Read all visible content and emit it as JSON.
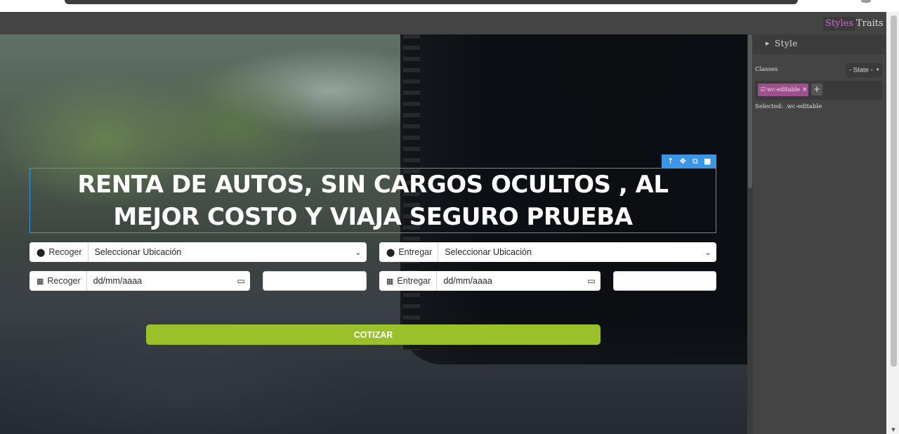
{
  "panel": {
    "tabs": [
      {
        "label": "Styles",
        "active": true
      },
      {
        "label": "Traits",
        "active": false
      }
    ],
    "sector_title": "Style",
    "classes_label": "Classes",
    "state_select": "- State -",
    "class_tag": "wc-editable",
    "class_tag_remove": "×",
    "add_class": "+",
    "selected_label": "Selected:",
    "selected_value": ".wc-editable"
  },
  "hero": {
    "title": "RENTA DE AUTOS, SIN CARGOS OCULTOS , AL MEJOR COSTO Y VIAJA SEGURO PRUEBA"
  },
  "selection_toolbar": {
    "icons": [
      "arrow-up-icon",
      "move-icon",
      "clone-icon",
      "delete-icon"
    ]
  },
  "form": {
    "pickup_location": {
      "prefix": "Recoger",
      "value": "Seleccionar Ubicación",
      "icon": "map-marker-icon"
    },
    "dropoff_location": {
      "prefix": "Entregar",
      "value": "Seleccionar Ubicación",
      "icon": "map-marker-icon"
    },
    "pickup_date": {
      "prefix": "Recoger",
      "placeholder": "dd/mm/aaaa",
      "icon": "calendar-icon"
    },
    "dropoff_date": {
      "prefix": "Entregar",
      "placeholder": "dd/mm/aaaa",
      "icon": "calendar-icon"
    },
    "pickup_time": {
      "value": ""
    },
    "dropoff_time": {
      "value": ""
    },
    "submit_label": "COTIZAR"
  },
  "colors": {
    "accent_selection": "#3b97e3",
    "submit_button": "#9bc12a",
    "class_tag": "#9e4f8d",
    "active_tab": "#c86fc9",
    "panel_bg": "#444444"
  }
}
